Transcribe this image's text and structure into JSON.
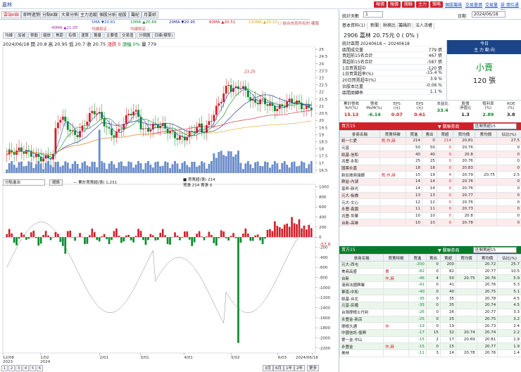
{
  "window": {
    "title": "嘉林"
  },
  "top_buttons": [
    "報價",
    "報價",
    "關聯",
    "主力",
    "策略"
  ],
  "top_links": [
    "個股籌碼",
    "交易量價",
    "交易量",
    "設 價位通知"
  ],
  "chart_tabs": [
    "雲端K線",
    "即時進勢",
    "分點K線",
    "大單分佈",
    "主力追蹤",
    "個股分析",
    "組股",
    "籌紀",
    "月要綜"
  ],
  "ma_legend": [
    {
      "label": "5MA ▼20.81",
      "color": "#1a4fbf"
    },
    {
      "label": "10MA ▲20.89",
      "color": "#0a8a2a"
    },
    {
      "label": "20MA ▼20.95",
      "color": "#1a1a8a"
    },
    {
      "label": "60MA ▲20.51",
      "color": "#d1202a"
    },
    {
      "label": "120MA ▲20.10",
      "color": "#e8a020"
    },
    {
      "label": "40MA ▲21.05",
      "color": "#9a2ab0"
    },
    {
      "label": "均線設定...",
      "color": "#c05050"
    },
    {
      "label": "均線設定...",
      "color": "#c05050"
    },
    {
      "label": "☐ 結合信息所有的 權報",
      "color": "#c05050"
    }
  ],
  "sub_tools": [
    "均線",
    "加減",
    "移動",
    "縮放",
    "焦距",
    "有價",
    "運算",
    "籌量",
    "主要值",
    "交易值",
    "分價圖",
    "日線(標準)"
  ],
  "ohlc": {
    "date": "2024/06/18",
    "open": "開 20.8",
    "high": "高 20.95",
    "low": "低 20.7",
    "close": "收 20.75",
    "change": "漲跌 0",
    "pct": "漲幅 0%",
    "vol": "量 779"
  },
  "chart_data": {
    "type": "candlestick",
    "title": "",
    "x_labels": [
      "12/08\n2023",
      "1/02\n2024",
      "2/01",
      "3/01",
      "4/01",
      "5/02",
      "6/03",
      "2024/06/18"
    ],
    "y_ticks": [
      16.5,
      17,
      17.5,
      18,
      18.5,
      19,
      19.5,
      20,
      20.5,
      21,
      21.5,
      22,
      22.5,
      23,
      23.5,
      24,
      24.5,
      25
    ],
    "high_label": "23.25",
    "low_label": "18",
    "indicator_y_ticks": [
      1000,
      800,
      600,
      400,
      200,
      0,
      -200,
      -400,
      -600,
      -800,
      -1000,
      -1200,
      -1400,
      -1600,
      -1800,
      -2000,
      -2200
    ],
    "indicator_current": "-57.6"
  },
  "indicator": {
    "selector": "分點進出",
    "button": "總設",
    "line1": "— 累計買賣超(張) 1,231",
    "line2": "■ 買賣超(張) 214\n買張 214 賣張 0"
  },
  "pager": {
    "pages": [
      "1",
      "2",
      "3",
      "4",
      "5",
      "6"
    ],
    "ranges": [
      "3月",
      "6月",
      "1年",
      "2年",
      "更多"
    ]
  },
  "right_panel": {
    "header": {
      "label": "統計天數",
      "value": "1",
      "date_label": "日期",
      "date": "2024/06/18"
    },
    "tabs": [
      "基本資料(1)",
      "新聞",
      "財務比",
      "籌碼的",
      "法人活權"
    ],
    "stock": {
      "code": "2906",
      "name": "嘉林",
      "price": "20.75元",
      "change": "0 ( 0% )"
    },
    "stats": [
      {
        "k": "統計區間 20240618 ~ 20240618",
        "v": ""
      },
      {
        "k": "區間成交量",
        "v": "779 張"
      },
      {
        "k": "買超前15名合計",
        "v": "467 張"
      },
      {
        "k": "賣超前15名合計",
        "v": "-587 張"
      },
      {
        "k": "1日買賣超中",
        "v": "-120 張"
      },
      {
        "k": "1日買賣超率(%)",
        "v": "-15.4 %"
      },
      {
        "k": "20日買賣超中(%)",
        "v": "3.9 %"
      },
      {
        "k": "佔股本比重",
        "v": "-0.06 %"
      },
      {
        "k": "區間周轉率",
        "v": "1.1 %"
      }
    ],
    "main_force": {
      "title_1": "今日",
      "title_2": "主 力 動 向",
      "side": "小賣",
      "qty": "120 張"
    },
    "ratios": [
      {
        "l": "累計營收\nYoY(%)",
        "v": "15.13",
        "c": "#d1202a"
      },
      {
        "l": "營收\nMoM(%)",
        "v": "-6.14",
        "c": "#0a8a2a"
      },
      {
        "l": "EPS\n(元)",
        "v": "0.07",
        "c": "#d1202a"
      },
      {
        "l": "EPS\n(元)",
        "v": "0.61",
        "c": "#d1202a"
      },
      {
        "l": "本益比",
        "v": "33.4",
        "c": "#0a8a2a"
      },
      {
        "l": "股價\n淨值比",
        "v": "1.3",
        "c": "#222"
      },
      {
        "l": "殖利率\n(%)",
        "v": "2.89",
        "c": "#0a8a2a"
      },
      {
        "l": "ROE\n(%)",
        "v": "3.8",
        "c": "#222"
      }
    ],
    "buy": {
      "title": "買方15",
      "link_label": "▼ 關聯券商",
      "selector": "區間買超15",
      "headers": [
        "參商名稱",
        "買賣特徵",
        "買進",
        "賣出",
        "買超",
        "買均價",
        "賣均價",
        "佔比(%)"
      ],
      "rows": [
        [
          "統一仁愛",
          "買,作,麻",
          "214",
          "0",
          "214",
          "20.81",
          "",
          "27.5"
        ],
        [
          "元富",
          "",
          "50",
          "50",
          "0",
          "20.76",
          "",
          "0"
        ],
        [
          "凱基-信和",
          "",
          "40",
          "40",
          "0",
          "20.8",
          "",
          "0"
        ],
        [
          "兆豐-永和",
          "",
          "25",
          "25",
          "0",
          "20.76",
          "",
          "0"
        ],
        [
          "國票永嘉",
          "",
          "18",
          "18",
          "0",
          "20.83",
          "",
          "0"
        ],
        [
          "新加坡商瑞銀",
          "買,作,麻",
          "15",
          "19",
          "4",
          "20.79",
          "20.75",
          "2.5"
        ],
        [
          "群益-內湖",
          "",
          "14",
          "14",
          "0",
          "20.76",
          "",
          "0"
        ],
        [
          "富邦-新光",
          "",
          "14",
          "14",
          "0",
          "20.76",
          "",
          "0"
        ],
        [
          "元大-板橋",
          "",
          "13",
          "13",
          "0",
          "20.77",
          "",
          "0"
        ],
        [
          "元大-文心",
          "",
          "12",
          "12",
          "0",
          "20.76",
          "",
          "0"
        ],
        [
          "永豐-鑫園",
          "",
          "11",
          "11",
          "0",
          "20.73",
          "",
          "0"
        ],
        [
          "兆豐-世華",
          "",
          "10",
          "10",
          "0",
          "20.8",
          "",
          "0"
        ],
        [
          "台新-高雄",
          "",
          "10",
          "10",
          "0",
          "20.78",
          "",
          "0"
        ]
      ]
    },
    "sell": {
      "title": "賣方15",
      "link_label": "▼ 關聯券商",
      "selector": "區間賣超15",
      "headers": [
        "參商名稱",
        "買賣特徵",
        "買進",
        "賣出",
        "賣超",
        "買均價",
        "賣均價",
        "佔比(%)"
      ],
      "rows": [
        [
          "元大-西屯",
          "",
          "-200",
          "0",
          "200",
          "",
          "20.72",
          "25.7"
        ],
        [
          "美商高盛",
          "賣",
          "-82",
          "0",
          "82",
          "",
          "20.77",
          "10.5"
        ],
        [
          "台新",
          "作,麻",
          "-46",
          "4",
          "50",
          "20.75",
          "20.76",
          "5.9"
        ],
        [
          "港商法國興業",
          "",
          "-41",
          "0",
          "41",
          "",
          "20.76",
          "5.3"
        ],
        [
          "華南-中和",
          "",
          "-40",
          "0",
          "40",
          "",
          "20.75",
          "5.1"
        ],
        [
          "凱基-台北",
          "",
          "-35",
          "0",
          "35",
          "",
          "20.78",
          "4.5"
        ],
        [
          "元富-民權",
          "",
          "-35",
          "0",
          "35",
          "",
          "20.74",
          "4.5"
        ],
        [
          "台灣摩根士丹利",
          "",
          "-26",
          "0",
          "26",
          "",
          "20.77",
          "3.3"
        ],
        [
          "永豐金-新店",
          "",
          "-25",
          "0",
          "25",
          "",
          "20.75",
          "3.2"
        ],
        [
          "摩根大通",
          "作",
          "-19",
          "0",
          "19",
          "",
          "20.73",
          "2.4"
        ],
        [
          "中國信託-復興",
          "",
          "-17",
          "15",
          "32",
          "20.74",
          "20.74",
          "2.2"
        ],
        [
          "第一金-中山",
          "",
          "-15",
          "2",
          "17",
          "20.69",
          "20.81",
          "1.9"
        ],
        [
          "永豐金",
          "作,麻",
          "-15",
          "0",
          "15",
          "",
          "20.77",
          "1.9"
        ],
        [
          "美林",
          "",
          "-11",
          "3",
          "14",
          "20.78",
          "20.76",
          "1.4"
        ]
      ]
    }
  }
}
